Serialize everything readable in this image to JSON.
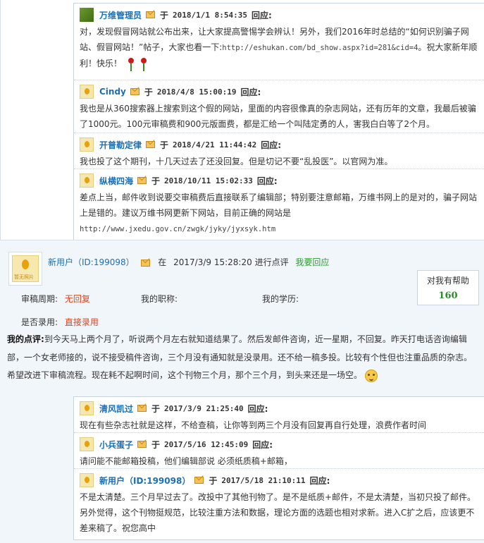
{
  "top_replies": [
    {
      "name": "万维管理员",
      "yu": "于",
      "time": "2018/1/1 8:54:35",
      "label": "回应:",
      "body_parts": [
        "对，发现假冒网站就公布出来，让大家提高警惕学会辨认！另外，我们2016年时总结的“如何识别骗子网站、假冒网站！”帖子，大家也看一下:",
        "http://eshukan.com/bd_show.aspx?id=281&cid=4",
        "。祝大家新年顺利！快乐！"
      ]
    },
    {
      "name": "Cindy",
      "yu": "于",
      "time": "2018/4/8 15:00:19",
      "label": "回应:",
      "body": "我也是从360搜索器上搜索到这个假的网站，里面的内容很像真的杂志网站，还有历年的文章，我最后被骗了1000元。100元审稿费和900元版面费，都是汇给一个叫陆定勇的人，害我白白等了2个月。"
    },
    {
      "name": "开普勒定律",
      "yu": "于",
      "time": "2018/4/21 11:44:42",
      "label": "回应:",
      "body": "我也投了这个期刊，十几天过去了还没回复。但是切记不要“乱投医”。以官网为准。"
    },
    {
      "name": "纵横四海",
      "yu": "于",
      "time": "2018/10/11 15:02:33",
      "label": "回应:",
      "body": "差点上当，邮件收到说要交审稿费后直接联系了编辑部；特别要注意邮箱，万维书网上的是对的，骗子网站上是错的。建议万维书网更新下网站，目前正确的网站是",
      "url": "http://www.jxedu.gov.cn/zwgk/jyky/jyxsyk.htm"
    }
  ],
  "post": {
    "avatar_caption": "暂无照片",
    "user": "新用户（ID:199098）",
    "zai": "在",
    "time": "2017/3/9 15:28:20",
    "action": "进行点评",
    "reply_link": "我要回应",
    "help_label": "对我有帮助",
    "help_count": "160",
    "review_period_label": "审稿周期:",
    "review_period_value": "无回复",
    "title_label": "我的职称:",
    "degree_label": "我的学历:",
    "accepted_label": "是否录用:",
    "accepted_value": "直接录用",
    "comment_label": "我的点评:",
    "comment_text": "到今天马上两个月了，听说两个月左右就知道结果了。然后发邮件咨询，近一星期，不回复。昨天打电话咨询编辑部，一个女老师接的，说不接受稿件咨询，三个月没有通知就是没录用。还不给一稿多投。比较有个性但也注重品质的杂志。希望改进下审稿流程。现在耗不起啊时间，这个刊物三个月，那个三个月，到头来还是一场空。"
  },
  "post_replies": [
    {
      "name": "清风凯过",
      "yu": "于",
      "time": "2017/3/9 21:25:40",
      "label": "回应:",
      "body": "现在有些杂志社就是这样，不给查稿，让你等到两三个月没有回复再自行处理，浪费作者时间"
    },
    {
      "name": "小兵蛋子",
      "yu": "于",
      "time": "2017/5/16 12:45:09",
      "label": "回应:",
      "body": "请问能不能邮箱投稿，他们编辑部说 必须纸质稿+邮箱，"
    },
    {
      "name": "新用户（ID:199098）",
      "yu": "于",
      "time": "2017/5/18 21:10:11",
      "label": "回应:",
      "body": "不是太清楚。三个月早过去了。改投中了其他刊物了。是不是纸质+邮件，不是太清楚，当初只投了邮件。另外觉得，这个刊物挺规范，比较注重方法和数据，理论方面的选题也相对求新。进入C扩之后，应该更不差来稿了。祝您高中"
    }
  ]
}
